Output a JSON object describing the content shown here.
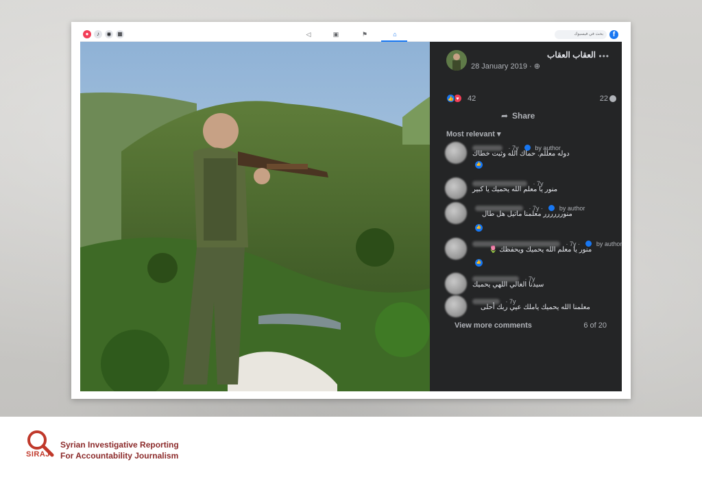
{
  "post": {
    "author": "العقاب العقاب",
    "date": "28 January 2019 ·",
    "reaction_count": "42",
    "comment_count": "22",
    "share_label": "Share",
    "sort_label": "Most relevant ▾",
    "more_icon": "•••"
  },
  "topbar": {
    "search_placeholder": "بحث في فيسبوك",
    "logo_glyph": "f"
  },
  "comments": [
    {
      "time": "· 7y",
      "author_badge": "by author",
      "text": "دوله معللم. حماك الله وثبت خطاك",
      "liked": true
    },
    {
      "time": "· 7y",
      "author_badge": "",
      "text": "منور يا معلم الله يحميك يا كبير",
      "liked": true
    },
    {
      "time": "· 7y ·",
      "author_badge": "by author",
      "text": "منورررررر معلمنا ماتيل هل طال",
      "liked": true
    },
    {
      "time": "· 7y ·",
      "author_badge": "by author",
      "text": "منور يا معلم الله يحميك ويحفظك 🌷",
      "liked": true
    },
    {
      "time": "· 7y",
      "author_badge": "",
      "text": "سيدنا الغالي اللهي يحميك",
      "liked": false
    },
    {
      "time": "· 7y",
      "author_badge": "",
      "text": "معلمنا الله يحميك ياملك عيي ربك أحلى",
      "liked": false
    }
  ],
  "footer": {
    "view_more": "View more comments",
    "pager": "6 of 20",
    "org_line1": "Syrian Investigative Reporting",
    "org_line2": "For Accountability Journalism",
    "logo_text": "SIRAJ"
  },
  "colors": {
    "panel_bg": "#242526",
    "fb_blue": "#1877f2",
    "brand_red": "#c0392b"
  }
}
